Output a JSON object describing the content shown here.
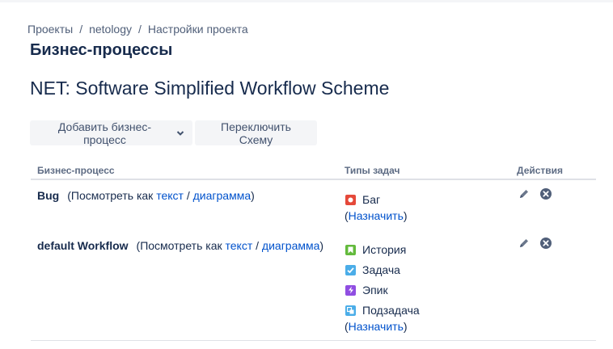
{
  "breadcrumb": {
    "items": [
      "Проекты",
      "netology",
      "Настройки проекта"
    ],
    "separator": "/"
  },
  "page": {
    "title": "Бизнес-процессы"
  },
  "scheme": {
    "title": "NET: Software Simplified Workflow Scheme"
  },
  "toolbar": {
    "add_label": "Добавить бизнес-процесс",
    "switch_label": "Переключить Схему"
  },
  "table": {
    "headers": {
      "workflow": "Бизнес-процесс",
      "issue_types": "Типы задач",
      "actions": "Действия"
    },
    "view_as": "(Посмотреть как",
    "text_link": "текст",
    "slash": "/",
    "diagram_link": "диаграмма",
    "close_paren": ")",
    "assign_open": "(",
    "assign_link": "Назначить",
    "assign_close": ")",
    "rows": [
      {
        "name": "Bug",
        "types": [
          {
            "label": "Баг",
            "icon": "bug-icon",
            "color": "#e5493a"
          }
        ]
      },
      {
        "name": "default Workflow",
        "types": [
          {
            "label": "История",
            "icon": "story-icon",
            "color": "#63ba3c"
          },
          {
            "label": "Задача",
            "icon": "task-icon",
            "color": "#4bade8"
          },
          {
            "label": "Эпик",
            "icon": "epic-icon",
            "color": "#904ee2"
          },
          {
            "label": "Подзадача",
            "icon": "subtask-icon",
            "color": "#4bade8"
          }
        ]
      }
    ]
  },
  "colors": {
    "link": "#0052cc",
    "text": "#172b4d",
    "button_bg": "#f4f5f7"
  }
}
